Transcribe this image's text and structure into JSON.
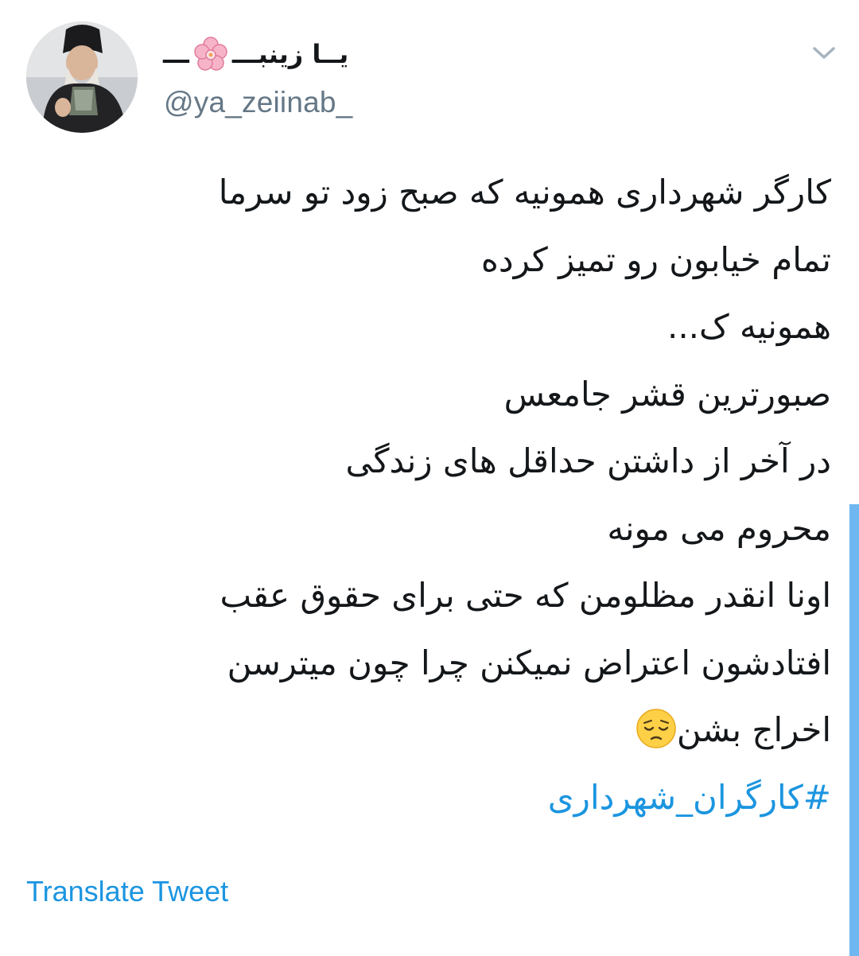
{
  "author": {
    "name_part_1": "یــا زینبـــ",
    "name_part_2": "ـــ",
    "handle": "@ya_zeiinab_",
    "avatar_icon": "profile-photo",
    "name_decoration_icon": "cherry-blossom-emoji"
  },
  "menu": {
    "caret_icon": "chevron-down-icon"
  },
  "tweet": {
    "lines": [
      "کارگر شهرداری همونیه که صبح زود تو سرما",
      "تمام خیابون رو تمیز کرده",
      "همونیه ک...",
      "صبورترین قشر جامعس",
      "در آخر از داشتن حداقل های زندگی",
      "محروم می مونه",
      "اونا انقدر مظلومن که حتی برای حقوق عقب",
      "افتادشون اعتراض نمیکنن چرا چون میترسن",
      "اخراج بشن"
    ],
    "last_line_emoji": "pensive-face-emoji",
    "hashtag": "#کارگران_شهرداری"
  },
  "translate_label": "Translate Tweet",
  "colors": {
    "text": "#14171a",
    "secondary": "#657786",
    "accent": "#1b95e0",
    "scrollbar": "#6eb7f0"
  }
}
